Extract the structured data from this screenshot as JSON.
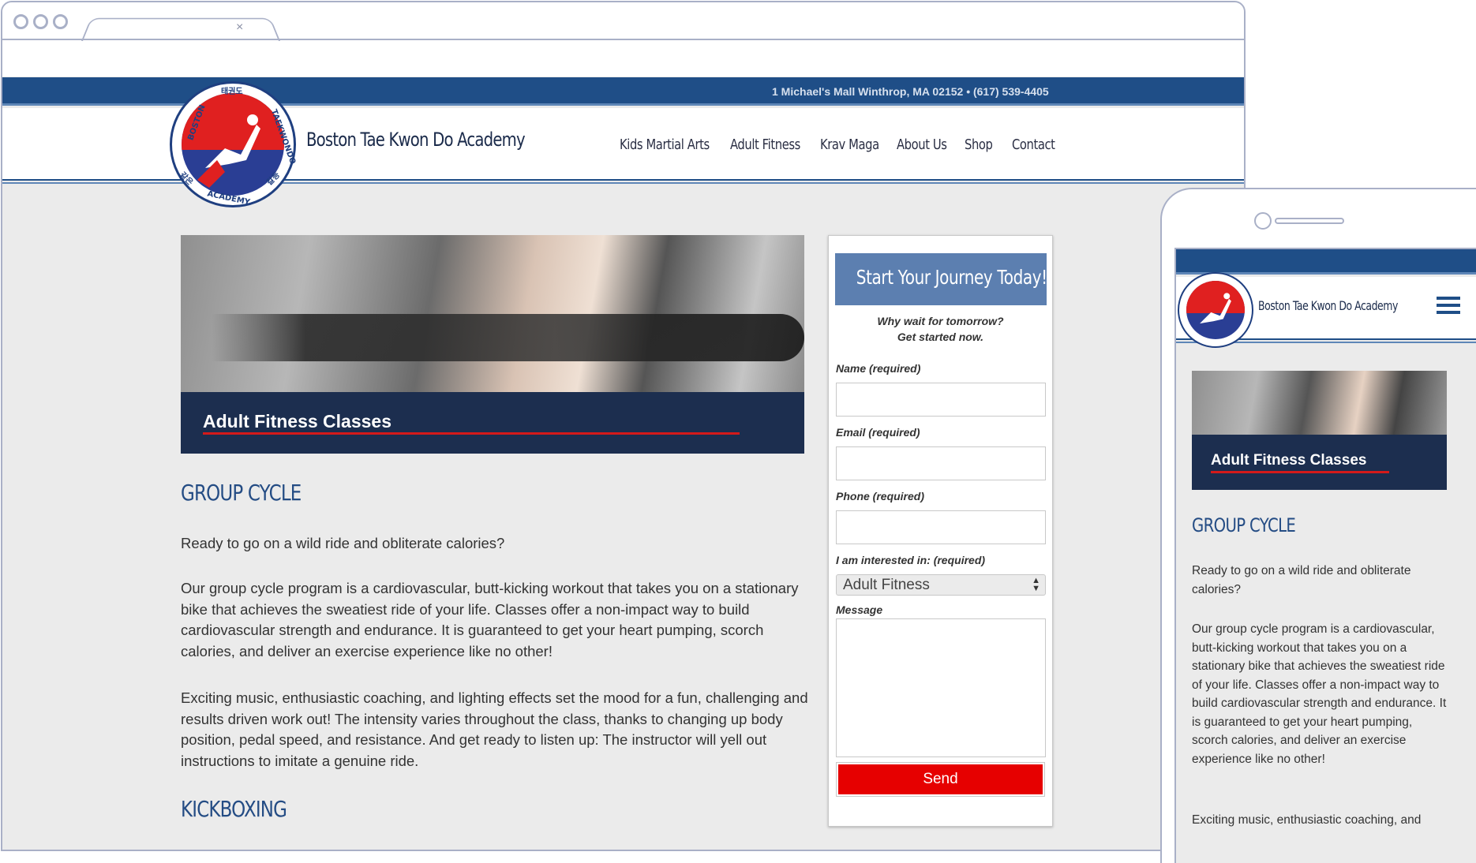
{
  "site": {
    "address_line": "1 Michael's Mall Winthrop, MA 02152 • (617) 539-4405",
    "name": "Boston Tae Kwon Do Academy",
    "logo_text": {
      "top_left": "BOSTON",
      "top_korean": "태권도",
      "right": "TAEKWONDO",
      "bottom": "ACADEMY",
      "bottom_left_korean": "같은",
      "bottom_right_korean": "칼등"
    }
  },
  "browser": {
    "tab_close": "×"
  },
  "nav": {
    "items": [
      {
        "label": "Kids Martial Arts"
      },
      {
        "label": "Adult Fitness"
      },
      {
        "label": "Krav Maga"
      },
      {
        "label": "About Us"
      },
      {
        "label": "Shop"
      },
      {
        "label": "Contact"
      }
    ]
  },
  "hero": {
    "title": "Adult Fitness Classes"
  },
  "content": {
    "heading1": "GROUP CYCLE",
    "para1": "Ready to go on a wild ride and obliterate calories?",
    "para2": "Our group cycle program is a cardiovascular, butt-kicking workout that takes you on a stationary bike that achieves the sweatiest ride of your life. Classes offer a non-impact way to build cardiovascular strength and endurance. It is guaranteed to get your heart pumping, scorch calories, and deliver an exercise experience like no other!",
    "para3": "Exciting music, enthusiastic coaching, and lighting effects set the mood for a fun, challenging and results driven work out! The intensity varies throughout the class, thanks to changing up body position, pedal speed, and resistance. And get ready to listen up: The instructor will yell out instructions to imitate a genuine ride.",
    "heading2": "KICKBOXING"
  },
  "form": {
    "title": "Start Your Journey Today!",
    "sub1": "Why wait for tomorrow?",
    "sub2": "Get started now.",
    "name_label": "Name (required)",
    "email_label": "Email (required)",
    "phone_label": "Phone (required)",
    "interest_label": "I am interested in: (required)",
    "interest_value": "Adult Fitness",
    "message_label": "Message",
    "send_label": "Send"
  },
  "mobile": {
    "para3_partial": "Exciting music, enthusiastic coaching, and"
  },
  "colors": {
    "brand_blue": "#1f4e87",
    "heading_blue": "#244c84",
    "accent_red": "#e60000",
    "form_header": "#5c7fb0",
    "hero_dark": "#1c2e4f"
  }
}
